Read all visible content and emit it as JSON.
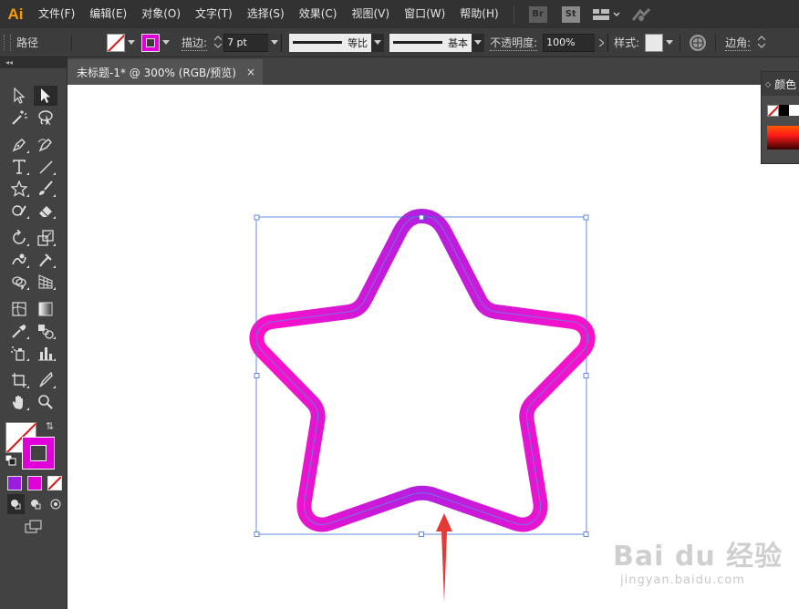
{
  "app": {
    "logo": "Ai",
    "menus": [
      "文件(F)",
      "编辑(E)",
      "对象(O)",
      "文字(T)",
      "选择(S)",
      "效果(C)",
      "视图(V)",
      "窗口(W)",
      "帮助(H)"
    ],
    "bridge_label": "Br",
    "stock_label": "St"
  },
  "control_bar": {
    "selection_label": "路径",
    "stroke_label": "描边:",
    "stroke_weight": "7 pt",
    "profile_label": "等比",
    "brush_label": "基本",
    "opacity_label": "不透明度:",
    "opacity_value": "100%",
    "style_label": "样式:",
    "corner_label": "边角:"
  },
  "document": {
    "tab_title": "未标题-1* @ 300% (RGB/预览)",
    "close_glyph": "×"
  },
  "panels": {
    "color_title": "颜色"
  },
  "colors": {
    "stroke_magenta": "#e600d6",
    "stroke_purple": "#9b1ee0",
    "selection_blue": "#3d6fd8",
    "arrow_red": "#e53935",
    "app_dark": "#323232"
  },
  "watermark": {
    "main": "Bai du 经验",
    "sub": "jingyan.baidu.com"
  }
}
